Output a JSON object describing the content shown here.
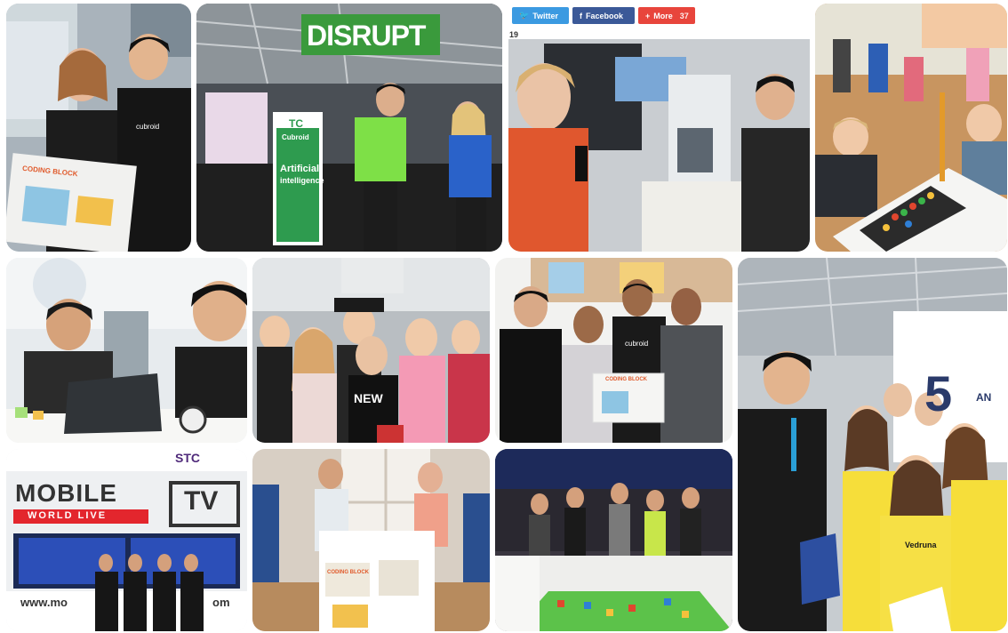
{
  "photos": {
    "p1": {
      "sign": "CODING BLOCK",
      "shirt": "cubroid"
    },
    "p2": {
      "banner": "DISRUPT",
      "tc": "TC",
      "cubroid": "Cubroid",
      "ai_line1": "Artificial",
      "ai_line2": "intelligence"
    },
    "p3": {
      "share": {
        "twitter": "Twitter",
        "facebook": "Facebook",
        "more": "More",
        "more_count": "37"
      },
      "page_num": "19"
    },
    "p6": {
      "shirt": "NEW"
    },
    "p7": {
      "shirt": "cubroid",
      "sign": "CODING BLOCK"
    },
    "p8": {
      "sign_number": "5",
      "sign_tail": "AN",
      "shirt": "Vedruna"
    },
    "p9": {
      "mobile": "MOBILE",
      "world_live": "WORLD LIVE",
      "tv": "TV",
      "stc": "STC",
      "url": "www.mo",
      "url_tail": "om"
    },
    "p10": {
      "box": "CODING BLOCK"
    }
  },
  "colors": {
    "green_banner": "#3a9a3c",
    "share_twitter": "#3b9ae1",
    "share_facebook": "#3b5998",
    "share_more": "#e8453c"
  }
}
